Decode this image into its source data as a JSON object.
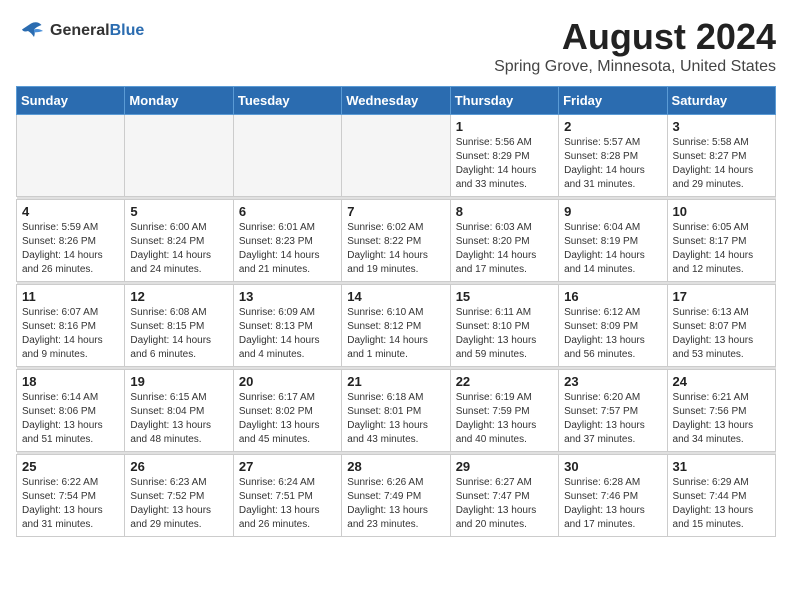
{
  "logo": {
    "line1": "General",
    "line2": "Blue"
  },
  "title": "August 2024",
  "subtitle": "Spring Grove, Minnesota, United States",
  "days_of_week": [
    "Sunday",
    "Monday",
    "Tuesday",
    "Wednesday",
    "Thursday",
    "Friday",
    "Saturday"
  ],
  "weeks": [
    [
      {
        "day": "",
        "info": ""
      },
      {
        "day": "",
        "info": ""
      },
      {
        "day": "",
        "info": ""
      },
      {
        "day": "",
        "info": ""
      },
      {
        "day": "1",
        "info": "Sunrise: 5:56 AM\nSunset: 8:29 PM\nDaylight: 14 hours\nand 33 minutes."
      },
      {
        "day": "2",
        "info": "Sunrise: 5:57 AM\nSunset: 8:28 PM\nDaylight: 14 hours\nand 31 minutes."
      },
      {
        "day": "3",
        "info": "Sunrise: 5:58 AM\nSunset: 8:27 PM\nDaylight: 14 hours\nand 29 minutes."
      }
    ],
    [
      {
        "day": "4",
        "info": "Sunrise: 5:59 AM\nSunset: 8:26 PM\nDaylight: 14 hours\nand 26 minutes."
      },
      {
        "day": "5",
        "info": "Sunrise: 6:00 AM\nSunset: 8:24 PM\nDaylight: 14 hours\nand 24 minutes."
      },
      {
        "day": "6",
        "info": "Sunrise: 6:01 AM\nSunset: 8:23 PM\nDaylight: 14 hours\nand 21 minutes."
      },
      {
        "day": "7",
        "info": "Sunrise: 6:02 AM\nSunset: 8:22 PM\nDaylight: 14 hours\nand 19 minutes."
      },
      {
        "day": "8",
        "info": "Sunrise: 6:03 AM\nSunset: 8:20 PM\nDaylight: 14 hours\nand 17 minutes."
      },
      {
        "day": "9",
        "info": "Sunrise: 6:04 AM\nSunset: 8:19 PM\nDaylight: 14 hours\nand 14 minutes."
      },
      {
        "day": "10",
        "info": "Sunrise: 6:05 AM\nSunset: 8:17 PM\nDaylight: 14 hours\nand 12 minutes."
      }
    ],
    [
      {
        "day": "11",
        "info": "Sunrise: 6:07 AM\nSunset: 8:16 PM\nDaylight: 14 hours\nand 9 minutes."
      },
      {
        "day": "12",
        "info": "Sunrise: 6:08 AM\nSunset: 8:15 PM\nDaylight: 14 hours\nand 6 minutes."
      },
      {
        "day": "13",
        "info": "Sunrise: 6:09 AM\nSunset: 8:13 PM\nDaylight: 14 hours\nand 4 minutes."
      },
      {
        "day": "14",
        "info": "Sunrise: 6:10 AM\nSunset: 8:12 PM\nDaylight: 14 hours\nand 1 minute."
      },
      {
        "day": "15",
        "info": "Sunrise: 6:11 AM\nSunset: 8:10 PM\nDaylight: 13 hours\nand 59 minutes."
      },
      {
        "day": "16",
        "info": "Sunrise: 6:12 AM\nSunset: 8:09 PM\nDaylight: 13 hours\nand 56 minutes."
      },
      {
        "day": "17",
        "info": "Sunrise: 6:13 AM\nSunset: 8:07 PM\nDaylight: 13 hours\nand 53 minutes."
      }
    ],
    [
      {
        "day": "18",
        "info": "Sunrise: 6:14 AM\nSunset: 8:06 PM\nDaylight: 13 hours\nand 51 minutes."
      },
      {
        "day": "19",
        "info": "Sunrise: 6:15 AM\nSunset: 8:04 PM\nDaylight: 13 hours\nand 48 minutes."
      },
      {
        "day": "20",
        "info": "Sunrise: 6:17 AM\nSunset: 8:02 PM\nDaylight: 13 hours\nand 45 minutes."
      },
      {
        "day": "21",
        "info": "Sunrise: 6:18 AM\nSunset: 8:01 PM\nDaylight: 13 hours\nand 43 minutes."
      },
      {
        "day": "22",
        "info": "Sunrise: 6:19 AM\nSunset: 7:59 PM\nDaylight: 13 hours\nand 40 minutes."
      },
      {
        "day": "23",
        "info": "Sunrise: 6:20 AM\nSunset: 7:57 PM\nDaylight: 13 hours\nand 37 minutes."
      },
      {
        "day": "24",
        "info": "Sunrise: 6:21 AM\nSunset: 7:56 PM\nDaylight: 13 hours\nand 34 minutes."
      }
    ],
    [
      {
        "day": "25",
        "info": "Sunrise: 6:22 AM\nSunset: 7:54 PM\nDaylight: 13 hours\nand 31 minutes."
      },
      {
        "day": "26",
        "info": "Sunrise: 6:23 AM\nSunset: 7:52 PM\nDaylight: 13 hours\nand 29 minutes."
      },
      {
        "day": "27",
        "info": "Sunrise: 6:24 AM\nSunset: 7:51 PM\nDaylight: 13 hours\nand 26 minutes."
      },
      {
        "day": "28",
        "info": "Sunrise: 6:26 AM\nSunset: 7:49 PM\nDaylight: 13 hours\nand 23 minutes."
      },
      {
        "day": "29",
        "info": "Sunrise: 6:27 AM\nSunset: 7:47 PM\nDaylight: 13 hours\nand 20 minutes."
      },
      {
        "day": "30",
        "info": "Sunrise: 6:28 AM\nSunset: 7:46 PM\nDaylight: 13 hours\nand 17 minutes."
      },
      {
        "day": "31",
        "info": "Sunrise: 6:29 AM\nSunset: 7:44 PM\nDaylight: 13 hours\nand 15 minutes."
      }
    ]
  ]
}
